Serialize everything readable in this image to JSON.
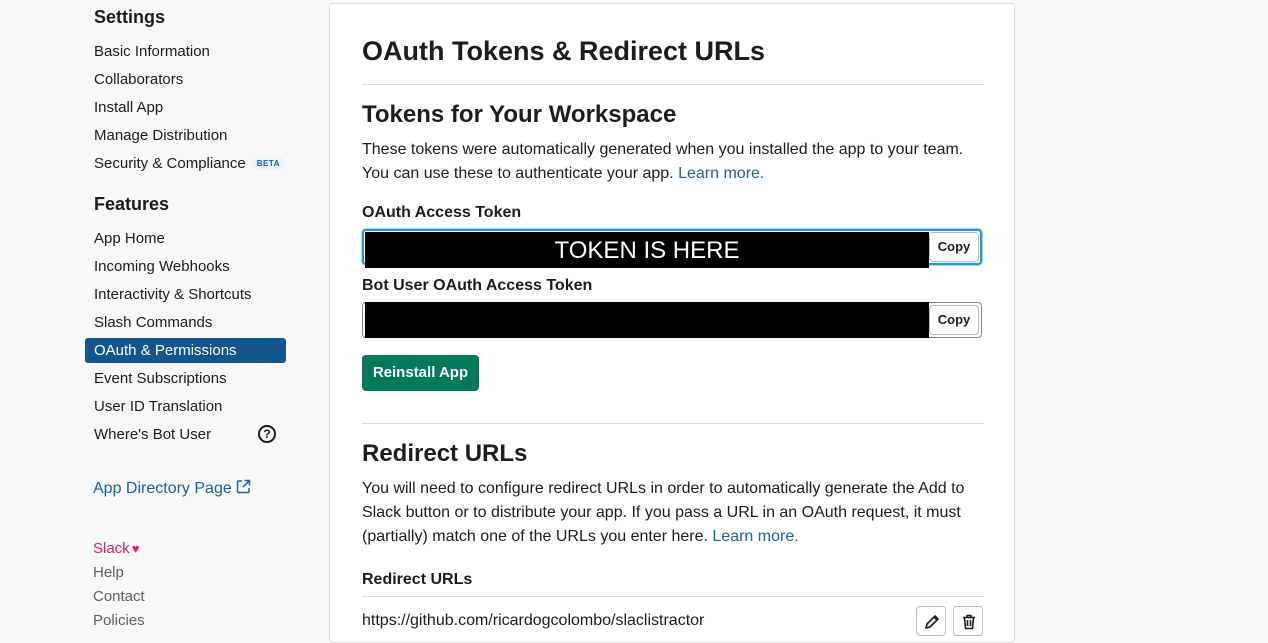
{
  "sidebar": {
    "settings_heading": "Settings",
    "settings_items": [
      {
        "label": "Basic Information"
      },
      {
        "label": "Collaborators"
      },
      {
        "label": "Install App"
      },
      {
        "label": "Manage Distribution"
      },
      {
        "label": "Security & Compliance",
        "badge": "BETA"
      }
    ],
    "features_heading": "Features",
    "features_items": [
      {
        "label": "App Home"
      },
      {
        "label": "Incoming Webhooks"
      },
      {
        "label": "Interactivity & Shortcuts"
      },
      {
        "label": "Slash Commands"
      },
      {
        "label": "OAuth & Permissions",
        "active": true
      },
      {
        "label": "Event Subscriptions"
      },
      {
        "label": "User ID Translation"
      },
      {
        "label": "Where's Bot User"
      }
    ],
    "help_icon_glyph": "?",
    "app_directory_link": "App Directory Page",
    "footer": {
      "slack": "Slack",
      "heart": "♥",
      "help": "Help",
      "contact": "Contact",
      "policies": "Policies"
    }
  },
  "main": {
    "title": "OAuth Tokens & Redirect URLs",
    "tokens_section": {
      "title": "Tokens for Your Workspace",
      "description": "These tokens were automatically generated when you installed the app to your team. You can use these to authenticate your app.",
      "learn_more": "Learn more.",
      "oauth_token_label": "OAuth Access Token",
      "oauth_token_overlay": "TOKEN IS HERE",
      "bot_token_label": "Bot User OAuth Access Token",
      "copy_label": "Copy",
      "reinstall_label": "Reinstall App"
    },
    "redirect_section": {
      "title": "Redirect URLs",
      "description": "You will need to configure redirect URLs in order to automatically generate the Add to Slack button or to distribute your app. If you pass a URL in an OAuth request, it must (partially) match one of the URLs you enter here.",
      "learn_more": "Learn more.",
      "list_label": "Redirect URLs",
      "urls": [
        "https://github.com/ricardogcolombo/slaclistractor"
      ]
    }
  },
  "colors": {
    "active_nav": "#13558f",
    "link": "#1264a3",
    "primary_button": "#007a5a",
    "slack_pink": "#e01e5a",
    "focus_ring": "#1d9bd1"
  },
  "icons": {
    "help": "question-circle-icon",
    "external": "external-link-icon",
    "heart": "heart-icon",
    "edit": "pencil-icon",
    "delete": "trash-icon"
  }
}
